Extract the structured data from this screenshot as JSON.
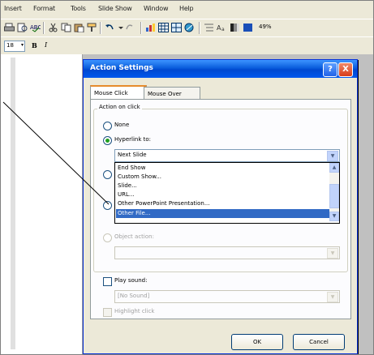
{
  "menubar": {
    "items": [
      "Insert",
      "Format",
      "Tools",
      "Slide Show",
      "Window",
      "Help"
    ]
  },
  "toolbar": {
    "zoom": "49%",
    "font_size": "18",
    "bold": "B",
    "italic": "I"
  },
  "dialog": {
    "title": "Action Settings",
    "help_glyph": "?",
    "close_glyph": "X",
    "tabs": [
      "Mouse Click",
      "Mouse Over"
    ],
    "group_label": "Action on click",
    "options": {
      "none": "None",
      "hyperlink": "Hyperlink to:",
      "object_action": "Object action:"
    },
    "hyperlink_value": "Next Slide",
    "dropdown_items": [
      "End Show",
      "Custom Show...",
      "Slide...",
      "URL...",
      "Other PowerPoint Presentation...",
      "Other File..."
    ],
    "selected_item": "Other File...",
    "play_sound_label": "Play sound:",
    "sound_value": "[No Sound]",
    "highlight_label": "Highlight click",
    "ok_label": "OK",
    "cancel_label": "Cancel"
  },
  "colors": {
    "titlebar": "#0a5ddc",
    "selection": "#316ac5",
    "face": "#ece9d8"
  }
}
